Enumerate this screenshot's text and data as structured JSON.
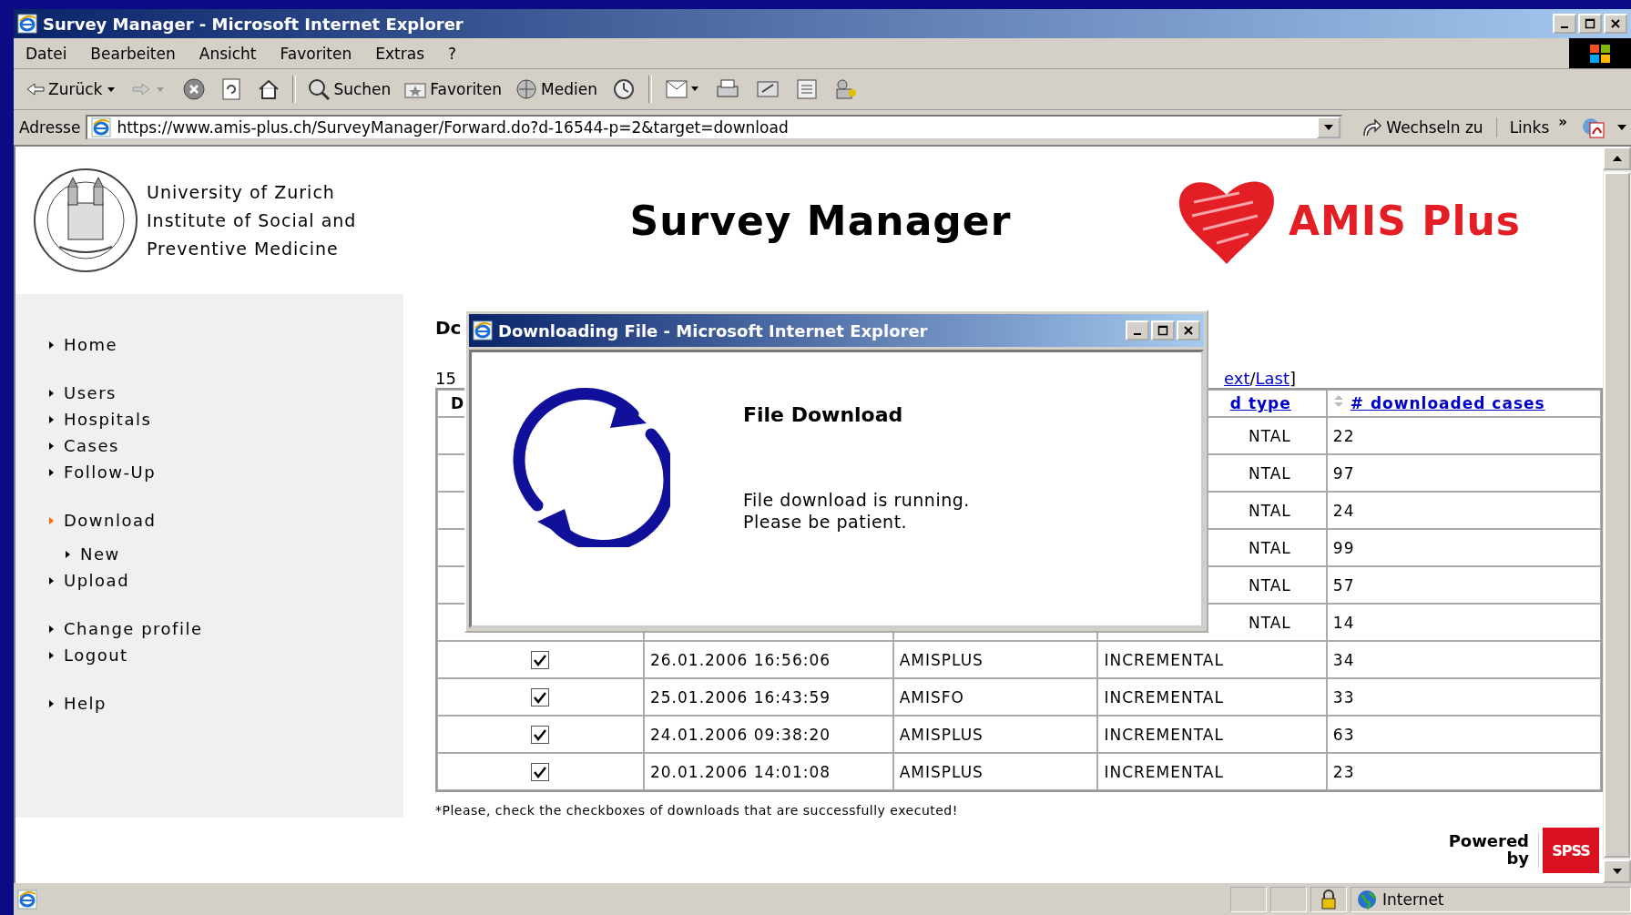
{
  "window": {
    "title": "Survey Manager - Microsoft Internet Explorer"
  },
  "menu": [
    "Datei",
    "Bearbeiten",
    "Ansicht",
    "Favoriten",
    "Extras",
    "?"
  ],
  "toolbar": {
    "back": "Zurück",
    "search": "Suchen",
    "favorites": "Favoriten",
    "media": "Medien"
  },
  "address_bar": {
    "label": "Adresse",
    "url": "https://www.amis-plus.ch/SurveyManager/Forward.do?d-16544-p=2&target=download",
    "go": "Wechseln zu",
    "links": "Links",
    "more": "»"
  },
  "header": {
    "institution": [
      "University of Zurich",
      "Institute of Social and",
      "Preventive Medicine"
    ],
    "title": "Survey Manager",
    "brand": "AMIS Plus"
  },
  "sidebar": {
    "groups": [
      {
        "items": [
          {
            "label": "Home",
            "selected": false
          }
        ]
      },
      {
        "items": [
          {
            "label": "Users",
            "selected": false
          },
          {
            "label": "Hospitals",
            "selected": false
          },
          {
            "label": "Cases",
            "selected": false
          },
          {
            "label": "Follow-Up",
            "selected": false
          }
        ]
      },
      {
        "items": [
          {
            "label": "Download",
            "selected": true,
            "children": [
              {
                "label": "New",
                "selected": false
              }
            ]
          },
          {
            "label": "Upload",
            "selected": false
          }
        ]
      },
      {
        "items": [
          {
            "label": "Change profile",
            "selected": false
          },
          {
            "label": "Logout",
            "selected": false
          }
        ]
      },
      {
        "items": [
          {
            "label": "Help",
            "selected": false
          }
        ]
      }
    ]
  },
  "content": {
    "heading": "Dc",
    "count": "15",
    "pagination": {
      "links": [
        "ext",
        "Last"
      ],
      "separator": "/",
      "end": "]"
    }
  },
  "table": {
    "headers": {
      "checkbox": "D",
      "type": "d type",
      "cases": "# downloaded cases"
    },
    "rows": [
      {
        "type": "NTAL",
        "cases": "22"
      },
      {
        "type": "NTAL",
        "cases": "97"
      },
      {
        "type": "NTAL",
        "cases": "24"
      },
      {
        "type": "NTAL",
        "cases": "99"
      },
      {
        "type": "NTAL",
        "cases": "57"
      },
      {
        "type": "NTAL",
        "cases": "14"
      },
      {
        "checked": true,
        "date": "26.01.2006 16:56:06",
        "source": "AMISPLUS",
        "type": "INCREMENTAL",
        "cases": "34"
      },
      {
        "checked": true,
        "date": "25.01.2006 16:43:59",
        "source": "AMISFO",
        "type": "INCREMENTAL",
        "cases": "33"
      },
      {
        "checked": true,
        "date": "24.01.2006 09:38:20",
        "source": "AMISPLUS",
        "type": "INCREMENTAL",
        "cases": "63"
      },
      {
        "checked": true,
        "date": "20.01.2006 14:01:08",
        "source": "AMISPLUS",
        "type": "INCREMENTAL",
        "cases": "23"
      }
    ]
  },
  "note": "*Please, check the checkboxes of downloads that are successfully executed!",
  "powered": {
    "line_1": "Powered",
    "line_2": "by",
    "logo": "SPSS"
  },
  "dialog": {
    "title": "Downloading File - Microsoft Internet Explorer",
    "heading": "File Download",
    "message": [
      "File download is running.",
      "Please be patient."
    ]
  },
  "status_bar": {
    "zone": "Internet"
  }
}
